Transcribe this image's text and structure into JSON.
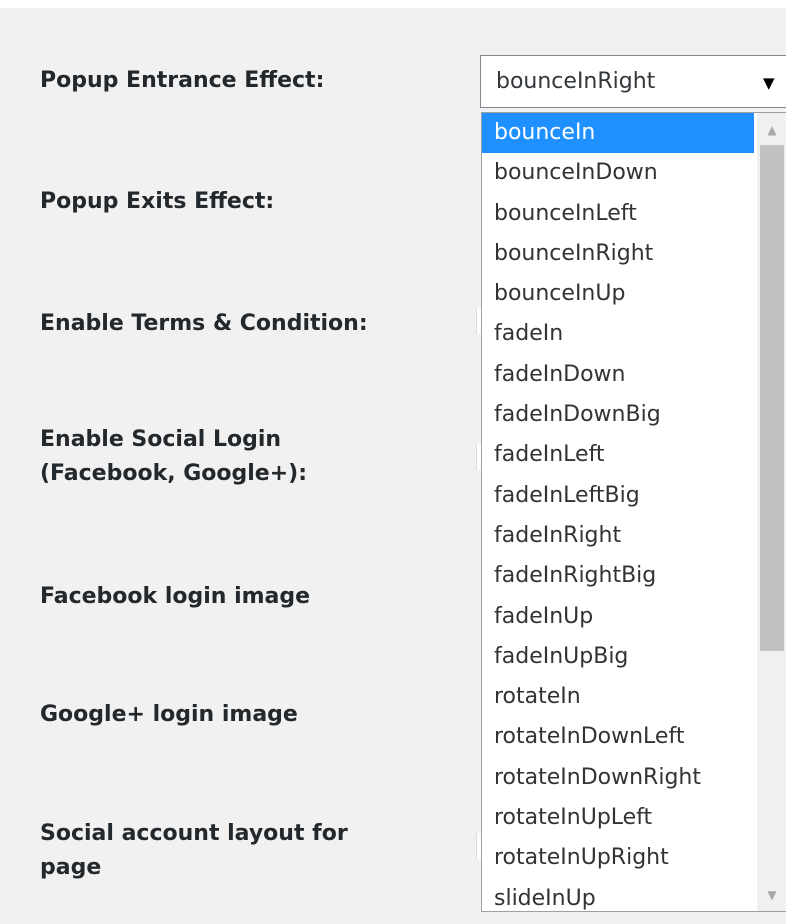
{
  "form": {
    "labels": [
      "Popup Entrance Effect:",
      "Popup Exits Effect:",
      "Enable Terms & Condition:",
      "Enable Social Login\n(Facebook, Google+):",
      "Facebook login image",
      "Google+ login image",
      "Social account layout for\npage"
    ]
  },
  "select": {
    "value": "bounceInRight",
    "arrow": "▼",
    "options": [
      "bounceIn",
      "bounceInDown",
      "bounceInLeft",
      "bounceInRight",
      "bounceInUp",
      "fadeIn",
      "fadeInDown",
      "fadeInDownBig",
      "fadeInLeft",
      "fadeInLeftBig",
      "fadeInRight",
      "fadeInRightBig",
      "fadeInUp",
      "fadeInUpBig",
      "rotateIn",
      "rotateInDownLeft",
      "rotateInDownRight",
      "rotateInUpLeft",
      "rotateInUpRight",
      "slideInUp"
    ],
    "highlighted_option": "bounceIn"
  },
  "scrollbar": {
    "up_arrow": "▲",
    "down_arrow": "▼"
  },
  "colors": {
    "highlight": "#1e90ff",
    "panel_background": "#f1f1f1",
    "label_text": "#23282d"
  }
}
